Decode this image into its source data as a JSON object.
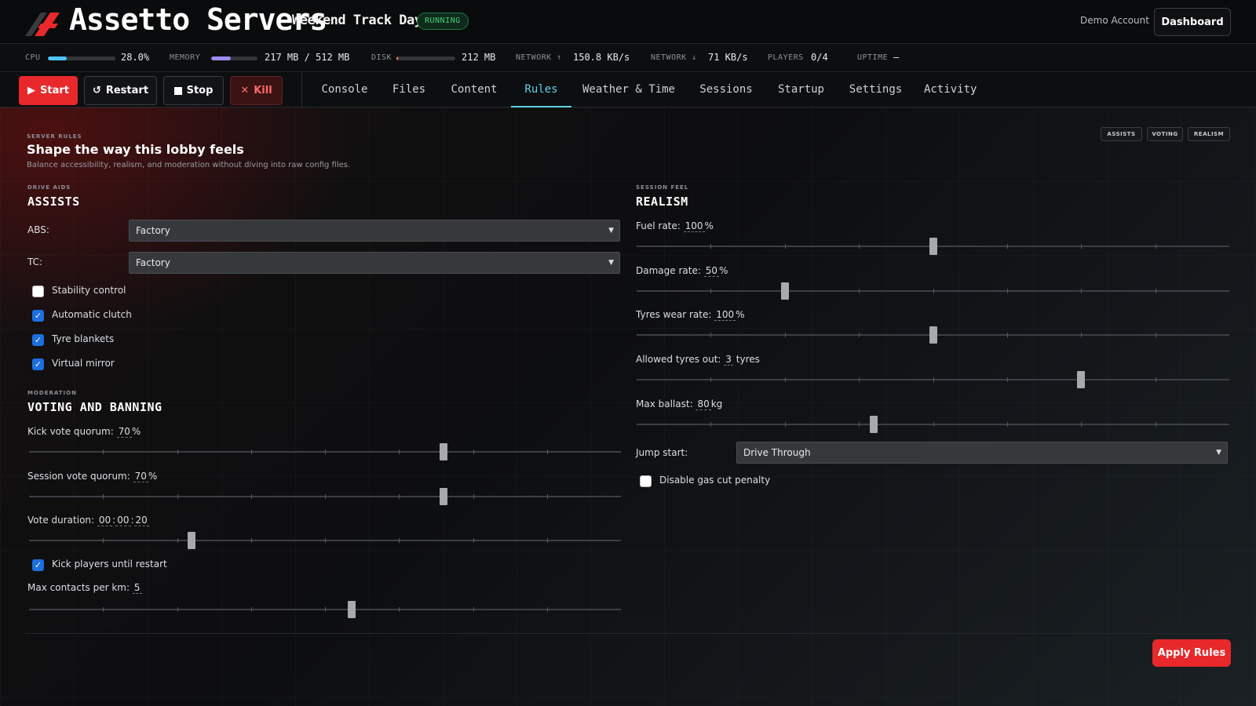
{
  "header": {
    "brand": "Assetto Servers",
    "server_name": "Weekend Track Day",
    "status": "RUNNING",
    "account": "Demo Account",
    "dashboard_label": "Dashboard"
  },
  "stats": {
    "cpu": {
      "label": "CPU",
      "value": "28.0%",
      "fraction": 0.28,
      "color": "#4fc3f7"
    },
    "memory": {
      "label": "MEMORY",
      "value": "217 MB / 512 MB",
      "fraction": 0.42,
      "color": "#9c8cf0"
    },
    "disk": {
      "label": "DISK",
      "value": "212 MB",
      "fraction": 0.02,
      "color": "#f0803a"
    },
    "net_up": {
      "label": "NETWORK ↑",
      "value": "150.8 KB/s"
    },
    "net_down": {
      "label": "NETWORK ↓",
      "value": "71 KB/s"
    },
    "players": {
      "label": "PLAYERS",
      "value": "0/4"
    },
    "uptime": {
      "label": "UPTIME",
      "value": "—"
    }
  },
  "power": {
    "start": "Start",
    "restart": "Restart",
    "stop": "Stop",
    "kill": "Kill"
  },
  "tabs": [
    "Console",
    "Files",
    "Content",
    "Rules",
    "Weather & Time",
    "Sessions",
    "Startup",
    "Settings",
    "Activity"
  ],
  "active_tab": "Rules",
  "page": {
    "kicker": "SERVER RULES",
    "title": "Shape the way this lobby feels",
    "subtitle": "Balance accessibility, realism, and moderation without diving into raw config files.",
    "chips": [
      "ASSISTS",
      "VOTING",
      "REALISM"
    ]
  },
  "assists": {
    "kicker": "DRIVE AIDS",
    "title": "ASSISTS",
    "abs_label": "ABS:",
    "abs_value": "Factory",
    "tc_label": "TC:",
    "tc_value": "Factory",
    "checks": [
      {
        "label": "Stability control",
        "checked": false
      },
      {
        "label": "Automatic clutch",
        "checked": true
      },
      {
        "label": "Tyre blankets",
        "checked": true
      },
      {
        "label": "Virtual mirror",
        "checked": true
      }
    ]
  },
  "voting": {
    "kicker": "MODERATION",
    "title": "VOTING AND BANNING",
    "kick_quorum": {
      "label": "Kick vote quorum:",
      "value": "70",
      "unit": "%",
      "fraction": 0.7
    },
    "session_quorum": {
      "label": "Session vote quorum:",
      "value": "70",
      "unit": "%",
      "fraction": 0.7
    },
    "vote_duration": {
      "label": "Vote duration:",
      "h": "00",
      "m": "00",
      "s": "20",
      "fraction": 0.275
    },
    "kick_until_restart": {
      "label": "Kick players until restart",
      "checked": true
    },
    "max_contacts": {
      "label": "Max contacts per km:",
      "value": "5",
      "fraction": 0.545
    }
  },
  "realism": {
    "kicker": "SESSION FEEL",
    "title": "REALISM",
    "fuel_rate": {
      "label": "Fuel rate:",
      "value": "100",
      "unit": "%",
      "fraction": 0.5
    },
    "damage_rate": {
      "label": "Damage rate:",
      "value": "50",
      "unit": "%",
      "fraction": 0.25
    },
    "tyre_wear": {
      "label": "Tyres wear rate:",
      "value": "100",
      "unit": "%",
      "fraction": 0.5
    },
    "tyres_out": {
      "label": "Allowed tyres out:",
      "value": "3",
      "unit": "tyres",
      "fraction": 0.75
    },
    "max_ballast": {
      "label": "Max ballast:",
      "value": "80",
      "unit": "kg",
      "fraction": 0.4
    },
    "jump_start_label": "Jump start:",
    "jump_start_value": "Drive Through",
    "gas_cut": {
      "label": "Disable gas cut penalty",
      "checked": false
    }
  },
  "apply_label": "Apply Rules"
}
